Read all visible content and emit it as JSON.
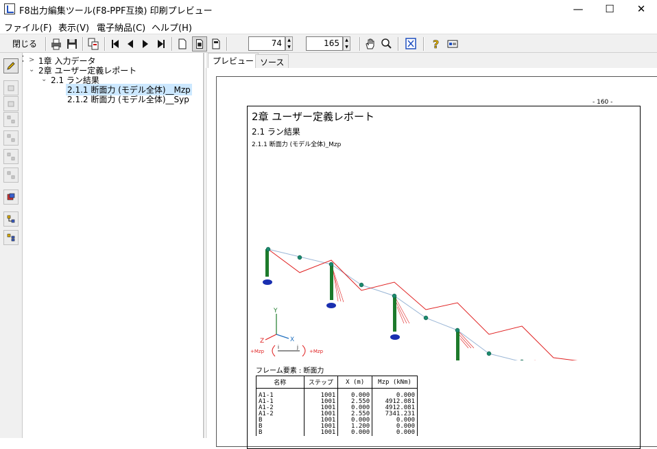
{
  "window": {
    "title": "F8出力編集ツール(F8-PPF互換) 印刷プレビュー",
    "minimize": "—",
    "maximize": "☐",
    "close": "✕"
  },
  "menu": [
    {
      "label": "ファイル(F)"
    },
    {
      "label": "表示(V)"
    },
    {
      "label": "電子納品(C)"
    },
    {
      "label": "ヘルプ(H)"
    }
  ],
  "toolbar": {
    "close_label": "閉じる(X)",
    "zoom_value": "74",
    "page_value": "165"
  },
  "tree": {
    "nodes": [
      {
        "label": "1章 入力データ"
      },
      {
        "label": "2章 ユーザー定義レポート"
      },
      {
        "label": "2.1 ラン結果"
      },
      {
        "label": "2.1.1 断面力 (モデル全体)__Mzp"
      },
      {
        "label": "2.1.2 断面力 (モデル全体)__Syp"
      }
    ]
  },
  "tabs": [
    {
      "label": "プレビュー"
    },
    {
      "label": "ソース"
    }
  ],
  "page": {
    "page_number": "- 160 -",
    "heading1": "2章 ユーザー定義レポート",
    "heading2": "2.1 ラン結果",
    "heading3": "2.1.1 断面力 (モデル全体)_Mzp",
    "axis_y": "Y",
    "axis_z": "Z",
    "axis_x": "X",
    "mzp_left": "+Mzp",
    "mzp_right": "+Mzp",
    "node_i": "i",
    "node_j": "j",
    "caption": "フレーム要素 : 断面力",
    "table": {
      "headers": [
        "名称",
        "ステップ",
        "X (m)",
        "Mzp (kNm)"
      ],
      "rows": [
        [
          "A1-1",
          "1001",
          "0.000",
          "0.000"
        ],
        [
          "A1-1",
          "1001",
          "2.550",
          "4912.081"
        ],
        [
          "A1-2",
          "1001",
          "0.000",
          "4912.081"
        ],
        [
          "A1-2",
          "1001",
          "2.550",
          "7341.231"
        ],
        [
          "B",
          "1001",
          "0.000",
          "0.000"
        ],
        [
          "B",
          "1001",
          "1.200",
          "0.000"
        ],
        [
          "B",
          "1001",
          "0.000",
          "0.000"
        ]
      ]
    }
  }
}
